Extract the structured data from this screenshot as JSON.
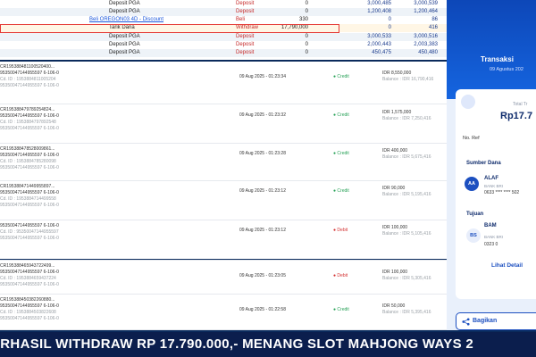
{
  "ledger": {
    "rows": [
      {
        "desc": "Deposit PGA",
        "type": "Deposit",
        "amount": "0",
        "debit": "3,000,485",
        "balance": "3,000,539"
      },
      {
        "desc": "Deposit PGA",
        "type": "Deposit",
        "amount": "0",
        "debit": "1,200,408",
        "balance": "1,200,464"
      },
      {
        "desc": "Beli OREGON03 4D - Discount",
        "type": "Beli",
        "amount": "330",
        "debit": "0",
        "balance": "86"
      },
      {
        "desc": "Tarik Dana",
        "type": "Withdraw",
        "amount": "17,790,000",
        "debit": "0",
        "balance": "416"
      },
      {
        "desc": "Deposit PGA",
        "type": "Deposit",
        "amount": "0",
        "debit": "3,000,533",
        "balance": "3,000,516"
      },
      {
        "desc": "Deposit PGA",
        "type": "Deposit",
        "amount": "0",
        "debit": "2,000,443",
        "balance": "2,003,383"
      },
      {
        "desc": "Deposit PGA",
        "type": "Deposit",
        "amount": "0",
        "debit": "450,475",
        "balance": "450,480"
      }
    ]
  },
  "transactions": [
    {
      "ref1": "CR195388481100520400...",
      "ref2": "95350047144955597 6-106-0",
      "ref3": "Cd. ID : 1953884811005204",
      "ref4": "95350047144955597 6-106-0",
      "date": "09 Aug 2025 - 01:23:34",
      "type": "Credit",
      "amount": "IDR 8,550,000",
      "balance": "Balance : IDR 16,790,416"
    },
    {
      "ref1": "CR195388479789254824...",
      "ref2": "95350047144955597 6-106-0",
      "ref3": "Cd. ID : 1953884797892548",
      "ref4": "95350047144955597 6-106-0",
      "date": "09 Aug 2025 - 01:23:32",
      "type": "Credit",
      "amount": "IDR 1,575,000",
      "balance": "Balance : IDR 7,250,416"
    },
    {
      "ref1": "CR195388478528009861...",
      "ref2": "95350047144955597 6-106-0",
      "ref3": "Cd. ID : 1953884785280098",
      "ref4": "95350047144955597 6-106-0",
      "date": "09 Aug 2025 - 01:23:28",
      "type": "Credit",
      "amount": "IDR 400,000",
      "balance": "Balance : IDR 5,675,416"
    },
    {
      "ref1": "CR195388471449955897...",
      "ref2": "95350047144955597 6-106-0",
      "ref3": "Cd. ID : 1953884714499558",
      "ref4": "95350047144955597 6-106-0",
      "date": "09 Aug 2025 - 01:23:12",
      "type": "Credit",
      "amount": "IDR 90,000",
      "balance": "Balance : IDR 5,195,416"
    },
    {
      "ref1": "95350047144955597 6-106-0",
      "ref2": "",
      "ref3": "Cd. ID : 95350047144955597",
      "ref4": "95350047144955597 6-106-0",
      "date": "09 Aug 2025 - 01:23:12",
      "type": "Debit",
      "amount": "IDR 100,000",
      "balance": "Balance : IDR 5,105,416"
    }
  ],
  "transactions2": [
    {
      "ref1": "CR195388465943722499...",
      "ref2": "95350047144955597 6-106-0",
      "ref3": "Cd. ID : 1953884659437224",
      "ref4": "95350047144955597 6-106-0",
      "date": "09 Aug 2025 - 01:23:05",
      "type": "Debit",
      "amount": "IDR 100,000",
      "balance": "Balance : IDR 5,305,416"
    },
    {
      "ref1": "CR195388450382260880...",
      "ref2": "95350047144955597 6-106-0",
      "ref3": "Cd. ID : 1953884503822608",
      "ref4": "95350047144955597 6-106-0",
      "date": "09 Aug 2025 - 01:22:58",
      "type": "Credit",
      "amount": "IDR 50,000",
      "balance": "Balance : IDR 5,395,416"
    }
  ],
  "receipt": {
    "title": "Transaksi",
    "date": "09 Agustus 202",
    "total_label": "Total Tr",
    "total": "Rp17.7",
    "ref_label": "No. Ref",
    "source_label": "Sumber Dana",
    "source_initials": "AA",
    "source_name": "ALAF",
    "source_bank": "BANK BRI",
    "source_acct": "0633 **** **** 502",
    "dest_label": "Tujuan",
    "dest_initials": "BS",
    "dest_name": "BAM",
    "dest_bank": "BANK BRI",
    "dest_acct": "0323 0",
    "detail_link": "Lihat Detail",
    "share_label": "Bagikan"
  },
  "banner": {
    "text": "ERHASIL WITHDRAW RP 17.790.000,- MENANG SLOT MAHJONG WAYS 2"
  },
  "colors": {
    "brand_blue": "#0d47b8",
    "credit_green": "#27a157",
    "debit_red": "#d32f2f",
    "highlight_red": "#e53935"
  }
}
